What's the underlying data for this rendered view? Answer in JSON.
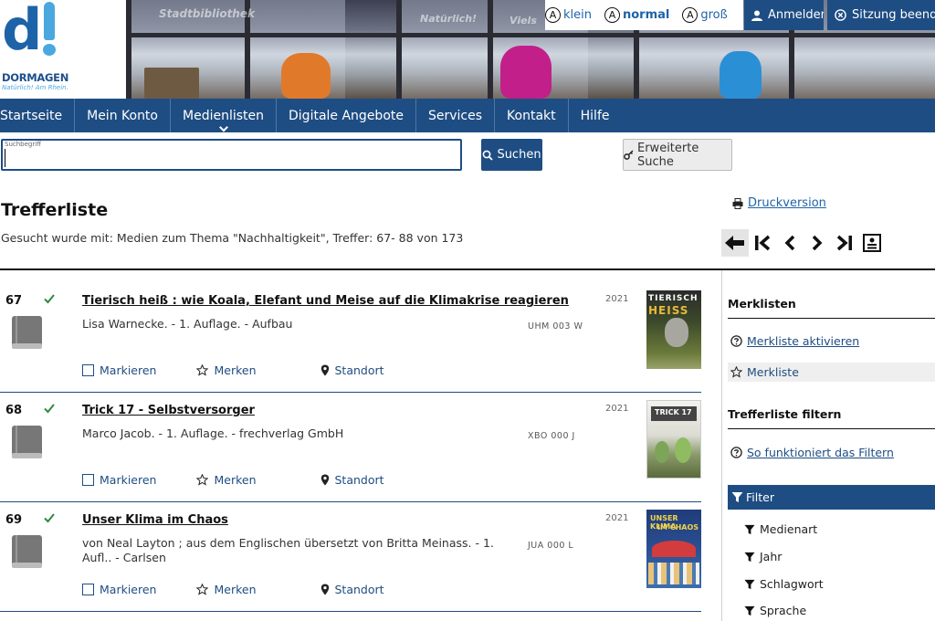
{
  "header": {
    "logo_name": "DORMAGEN",
    "logo_tagline": "Natürlich! Am Rhein.",
    "photo_signs": [
      "Stadtbibliothek",
      "Natürlich!",
      "Viels"
    ],
    "font_sizes": [
      {
        "label": "klein",
        "letter": "A"
      },
      {
        "label": "normal",
        "letter": "A"
      },
      {
        "label": "groß",
        "letter": "A"
      }
    ],
    "login_label": "Anmelden",
    "session_label": "Sitzung beenden"
  },
  "nav": {
    "items": [
      "Startseite",
      "Mein Konto",
      "Medienlisten",
      "Digitale Angebote",
      "Services",
      "Kontakt",
      "Hilfe"
    ]
  },
  "search": {
    "label": "Suchbegriff",
    "value": "",
    "button_label": "Suchen",
    "advanced_label": "Erweiterte Suche"
  },
  "results": {
    "title": "Trefferliste",
    "summary": "Gesucht wurde mit: Medien zum Thema \"Nachhaltigkeit\", Treffer: 67- 88 von 173",
    "print_label": "Druckversion",
    "action_mark": "Markieren",
    "action_remember": "Merken",
    "action_location": "Standort",
    "items": [
      {
        "num": "67",
        "title": "Tierisch heiß : wie Koala, Elefant und Meise auf die Klimakrise reagieren",
        "author": "Lisa Warnecke. - 1. Auflage. - Aufbau",
        "year": "2021",
        "signature": "UHM 003 W",
        "cover_title_1": "TIERISCH",
        "cover_title_2": "HEISS"
      },
      {
        "num": "68",
        "title": "Trick 17 - Selbstversorger",
        "author": "Marco Jacob. - 1. Auflage. - frechverlag GmbH",
        "year": "2021",
        "signature": "XBO 000 J",
        "cover_title_1": "TRICK 17",
        "cover_title_2": ""
      },
      {
        "num": "69",
        "title": "Unser Klima im Chaos",
        "author": "von Neal Layton ; aus dem Englischen übersetzt von Britta Meinass. - 1. Aufl.. - Carlsen",
        "year": "2021",
        "signature": "JUA 000 L",
        "cover_title_1": "UNSER KLIMA",
        "cover_title_2": "IM CHAOS"
      }
    ]
  },
  "sidebar": {
    "merklisten_heading": "Merklisten",
    "activate_label": "Merkliste aktivieren",
    "merkliste_label": "Merkliste",
    "filter_heading": "Trefferliste filtern",
    "filter_help_label": "So funktioniert das Filtern",
    "filter_bar_label": "Filter",
    "facets": [
      "Medienart",
      "Jahr",
      "Schlagwort",
      "Sprache"
    ]
  },
  "colors": {
    "primary": "#1e4d83",
    "link": "#1e63a7",
    "check": "#2e8b3a"
  }
}
